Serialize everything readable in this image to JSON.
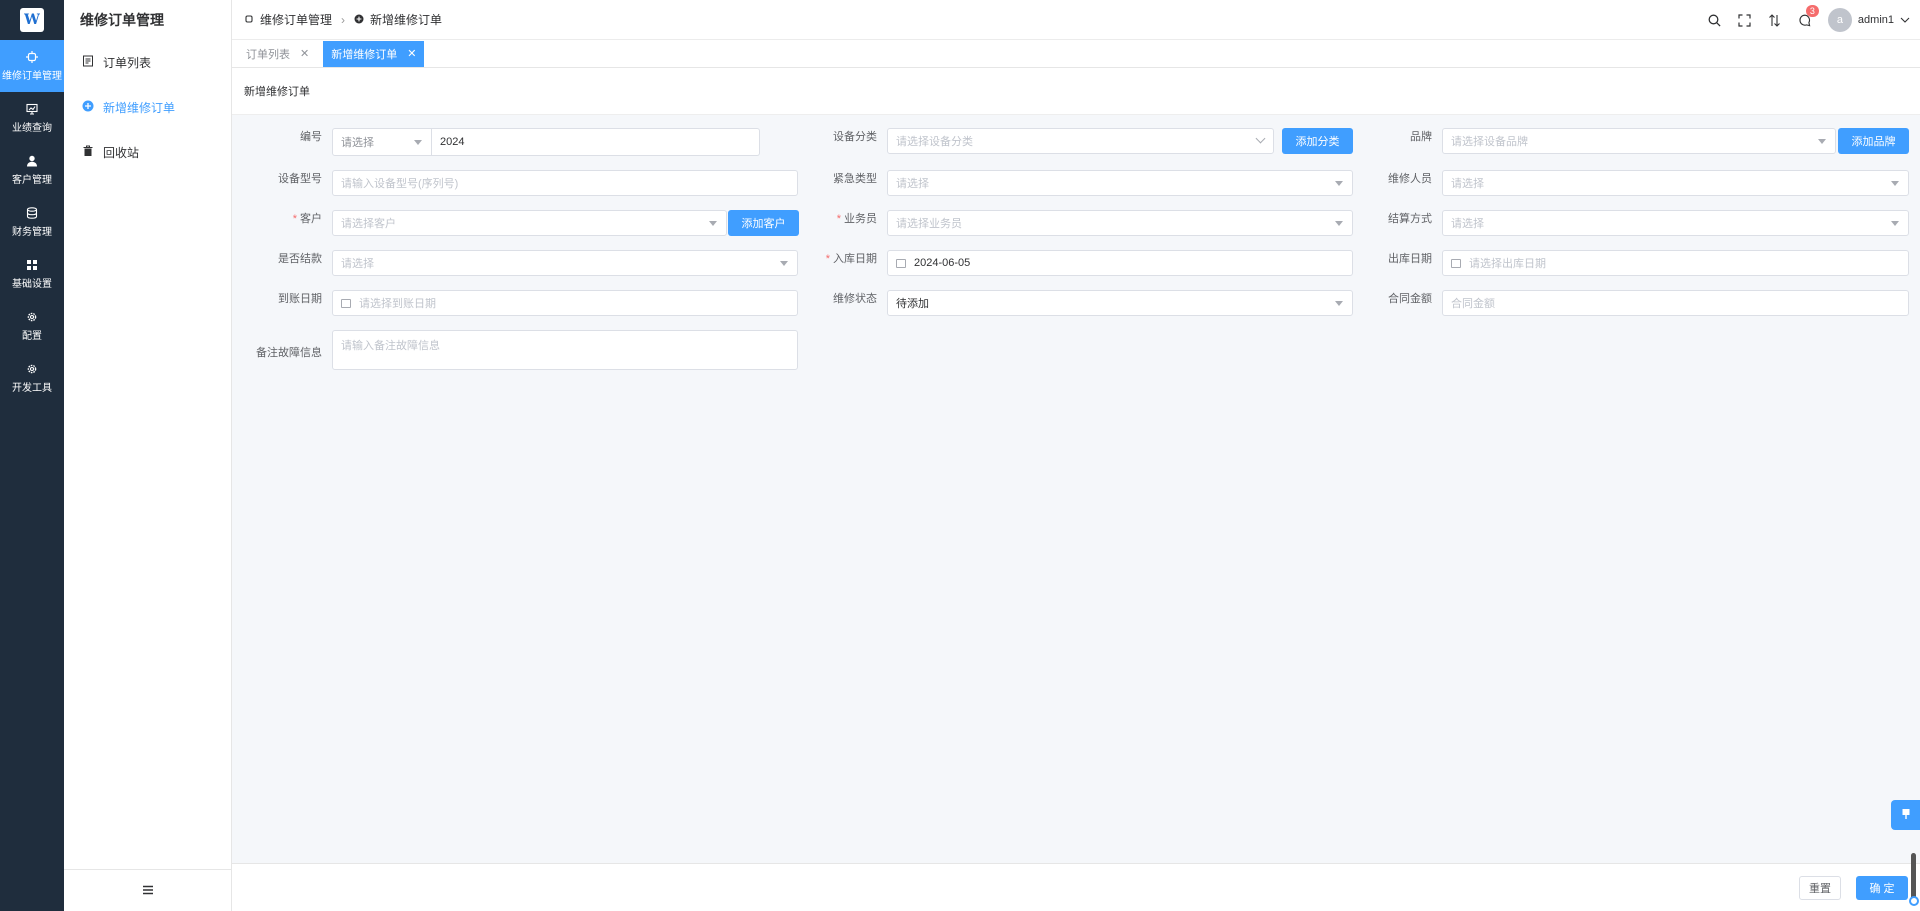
{
  "rail": {
    "logo": "W",
    "items": [
      {
        "label": "维修订单管理",
        "icon": "chip-icon",
        "active": true
      },
      {
        "label": "业绩查询",
        "icon": "chart-icon"
      },
      {
        "label": "客户管理",
        "icon": "user-icon"
      },
      {
        "label": "财务管理",
        "icon": "database-icon"
      },
      {
        "label": "基础设置",
        "icon": "grid-icon"
      },
      {
        "label": "配置",
        "icon": "gear-icon"
      },
      {
        "label": "开发工具",
        "icon": "gear-icon"
      }
    ]
  },
  "sidebar": {
    "title": "维修订单管理",
    "items": [
      {
        "label": "订单列表",
        "icon": "document-icon"
      },
      {
        "label": "新增维修订单",
        "icon": "plus-circle-icon",
        "active": true
      },
      {
        "label": "回收站",
        "icon": "trash-icon"
      }
    ]
  },
  "header": {
    "breadcrumb": [
      "维修订单管理",
      "新增维修订单"
    ],
    "badge_count": "3",
    "avatar_letter": "a",
    "username": "admin1"
  },
  "tabs": [
    {
      "label": "订单列表",
      "active": false
    },
    {
      "label": "新增维修订单",
      "active": true
    }
  ],
  "page": {
    "title": "新增维修订单"
  },
  "form": {
    "number": {
      "label": "编号",
      "prefix_placeholder": "请选择",
      "value": "2024"
    },
    "category": {
      "label": "设备分类",
      "placeholder": "请选择设备分类",
      "button": "添加分类"
    },
    "brand": {
      "label": "品牌",
      "placeholder": "请选择设备品牌",
      "button": "添加品牌"
    },
    "model": {
      "label": "设备型号",
      "placeholder": "请输入设备型号(序列号)"
    },
    "urgency": {
      "label": "紧急类型",
      "placeholder": "请选择"
    },
    "technician": {
      "label": "维修人员",
      "placeholder": "请选择"
    },
    "customer": {
      "label": "客户",
      "placeholder": "请选择客户",
      "button": "添加客户",
      "required": "*"
    },
    "salesman": {
      "label": "业务员",
      "placeholder": "请选择业务员",
      "required": "*"
    },
    "settlement": {
      "label": "结算方式",
      "placeholder": "请选择"
    },
    "settled": {
      "label": "是否结款",
      "placeholder": "请选择"
    },
    "in_date": {
      "label": "入库日期",
      "value": "2024-06-05",
      "required": "*"
    },
    "out_date": {
      "label": "出库日期",
      "placeholder": "请选择出库日期"
    },
    "arrival_date": {
      "label": "到账日期",
      "placeholder": "请选择到账日期"
    },
    "status": {
      "label": "维修状态",
      "value": "待添加"
    },
    "contract_amount": {
      "label": "合同金额",
      "placeholder": "合同金额"
    },
    "remark": {
      "label": "备注故障信息",
      "placeholder": "请输入备注故障信息"
    }
  },
  "footer": {
    "reset": "重置",
    "confirm": "确 定"
  },
  "colors": {
    "primary": "#409eff",
    "rail_bg": "#1f2d3d",
    "required": "#f56c6c"
  }
}
